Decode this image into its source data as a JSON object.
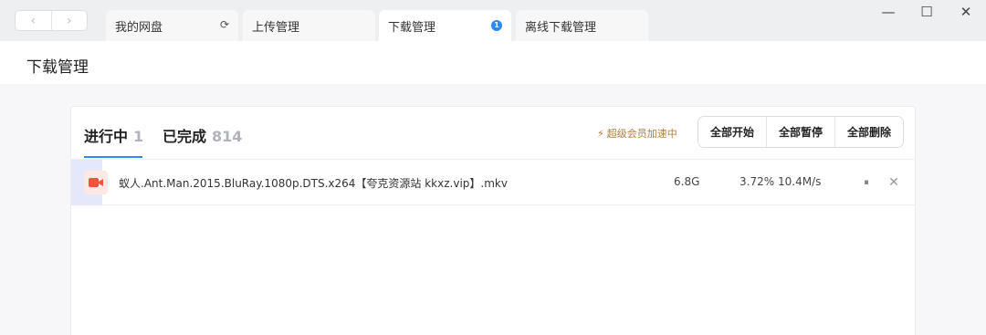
{
  "nav": {
    "back_icon": "chevron-left-icon",
    "forward_icon": "chevron-right-icon",
    "back_glyph": "‹",
    "forward_glyph": "›"
  },
  "tabs": [
    {
      "label": "我的网盘",
      "icon": "refresh-icon",
      "icon_glyph": "⟳",
      "active": false
    },
    {
      "label": "上传管理",
      "active": false
    },
    {
      "label": "下载管理",
      "badge": "1",
      "active": true
    },
    {
      "label": "离线下载管理",
      "active": false
    }
  ],
  "window_controls": {
    "minimize": "—",
    "maximize": "☐",
    "close": "✕"
  },
  "page": {
    "title": "下载管理"
  },
  "subtabs": {
    "in_progress": {
      "label": "进行中",
      "count": "1"
    },
    "completed": {
      "label": "已完成",
      "count": "814"
    }
  },
  "svip": {
    "icon": "lightning-icon",
    "glyph": "⚡",
    "label": "超级会员加速中"
  },
  "actions": {
    "start_all": "全部开始",
    "pause_all": "全部暂停",
    "delete_all": "全部删除"
  },
  "downloads": [
    {
      "filename": "蚁人.Ant.Man.2015.BluRay.1080p.DTS.x264【夸克资源站 kkxz.vip】.mkv",
      "size": "6.8G",
      "progress": "3.72%",
      "speed": "10.4M/s",
      "pause_glyph": "⏸",
      "delete_glyph": "✕"
    }
  ],
  "colors": {
    "accent": "#2a8cf3",
    "svip": "#b07d3e",
    "video_icon": "#f4533e",
    "row_highlight": "#e5e8fb"
  }
}
